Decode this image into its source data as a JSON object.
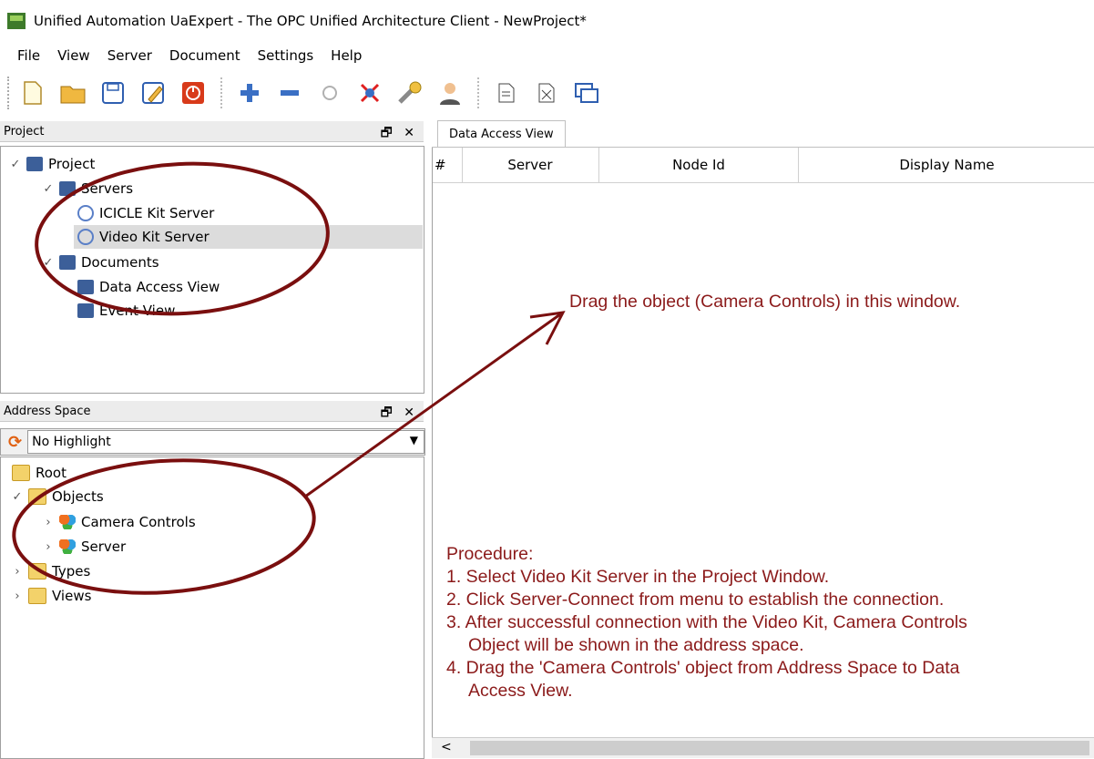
{
  "window": {
    "title": "Unified Automation UaExpert - The OPC Unified Architecture Client - NewProject*"
  },
  "menu": [
    {
      "label": "File"
    },
    {
      "label": "View"
    },
    {
      "label": "Server"
    },
    {
      "label": "Document"
    },
    {
      "label": "Settings"
    },
    {
      "label": "Help"
    }
  ],
  "project_panel": {
    "title": "Project",
    "buttons": "🗗 ✕",
    "items": [
      {
        "label": "Project"
      },
      {
        "label": "Servers"
      },
      {
        "label": "ICICLE Kit Server"
      },
      {
        "label": "Video Kit Server"
      },
      {
        "label": "Documents"
      },
      {
        "label": "Data Access View"
      },
      {
        "label": "Event View"
      }
    ]
  },
  "address_panel": {
    "title": "Address Space",
    "buttons": "🗗 ✕",
    "highlight": "No Highlight",
    "items": [
      {
        "label": "Root"
      },
      {
        "label": "Objects"
      },
      {
        "label": "Camera Controls"
      },
      {
        "label": "Server"
      },
      {
        "label": "Types"
      },
      {
        "label": "Views"
      }
    ]
  },
  "data_access": {
    "tab": "Data Access View",
    "columns": [
      "#",
      "Server",
      "Node Id",
      "Display Name"
    ]
  },
  "annotations": {
    "drag_hint": "Drag the object (Camera Controls) in this window.",
    "procedure_title": "Procedure:",
    "steps": [
      "1. Select Video Kit Server in the Project Window.",
      "2. Click Server-Connect from menu  to establish the connection.",
      "3. After successful connection with the Video Kit, Camera Controls",
      "Object will be shown in the address space.",
      "4. Drag the 'Camera Controls' object from Address Space to Data",
      "Access View."
    ],
    "color": "#8b1a1a"
  },
  "scrollbar": {
    "left_arrow": "<"
  }
}
